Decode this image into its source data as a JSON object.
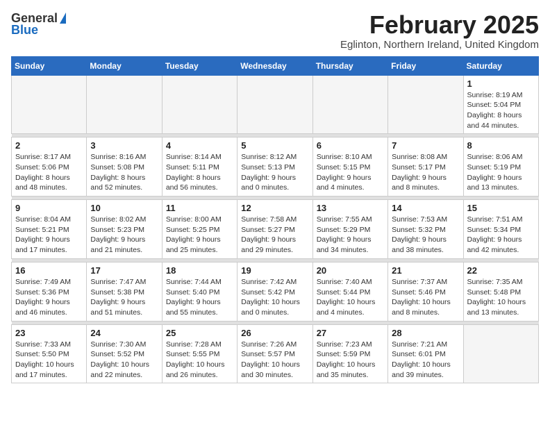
{
  "header": {
    "logo_general": "General",
    "logo_blue": "Blue",
    "title": "February 2025",
    "location": "Eglinton, Northern Ireland, United Kingdom"
  },
  "weekdays": [
    "Sunday",
    "Monday",
    "Tuesday",
    "Wednesday",
    "Thursday",
    "Friday",
    "Saturday"
  ],
  "weeks": [
    [
      {
        "day": "",
        "info": ""
      },
      {
        "day": "",
        "info": ""
      },
      {
        "day": "",
        "info": ""
      },
      {
        "day": "",
        "info": ""
      },
      {
        "day": "",
        "info": ""
      },
      {
        "day": "",
        "info": ""
      },
      {
        "day": "1",
        "info": "Sunrise: 8:19 AM\nSunset: 5:04 PM\nDaylight: 8 hours and 44 minutes."
      }
    ],
    [
      {
        "day": "2",
        "info": "Sunrise: 8:17 AM\nSunset: 5:06 PM\nDaylight: 8 hours and 48 minutes."
      },
      {
        "day": "3",
        "info": "Sunrise: 8:16 AM\nSunset: 5:08 PM\nDaylight: 8 hours and 52 minutes."
      },
      {
        "day": "4",
        "info": "Sunrise: 8:14 AM\nSunset: 5:11 PM\nDaylight: 8 hours and 56 minutes."
      },
      {
        "day": "5",
        "info": "Sunrise: 8:12 AM\nSunset: 5:13 PM\nDaylight: 9 hours and 0 minutes."
      },
      {
        "day": "6",
        "info": "Sunrise: 8:10 AM\nSunset: 5:15 PM\nDaylight: 9 hours and 4 minutes."
      },
      {
        "day": "7",
        "info": "Sunrise: 8:08 AM\nSunset: 5:17 PM\nDaylight: 9 hours and 8 minutes."
      },
      {
        "day": "8",
        "info": "Sunrise: 8:06 AM\nSunset: 5:19 PM\nDaylight: 9 hours and 13 minutes."
      }
    ],
    [
      {
        "day": "9",
        "info": "Sunrise: 8:04 AM\nSunset: 5:21 PM\nDaylight: 9 hours and 17 minutes."
      },
      {
        "day": "10",
        "info": "Sunrise: 8:02 AM\nSunset: 5:23 PM\nDaylight: 9 hours and 21 minutes."
      },
      {
        "day": "11",
        "info": "Sunrise: 8:00 AM\nSunset: 5:25 PM\nDaylight: 9 hours and 25 minutes."
      },
      {
        "day": "12",
        "info": "Sunrise: 7:58 AM\nSunset: 5:27 PM\nDaylight: 9 hours and 29 minutes."
      },
      {
        "day": "13",
        "info": "Sunrise: 7:55 AM\nSunset: 5:29 PM\nDaylight: 9 hours and 34 minutes."
      },
      {
        "day": "14",
        "info": "Sunrise: 7:53 AM\nSunset: 5:32 PM\nDaylight: 9 hours and 38 minutes."
      },
      {
        "day": "15",
        "info": "Sunrise: 7:51 AM\nSunset: 5:34 PM\nDaylight: 9 hours and 42 minutes."
      }
    ],
    [
      {
        "day": "16",
        "info": "Sunrise: 7:49 AM\nSunset: 5:36 PM\nDaylight: 9 hours and 46 minutes."
      },
      {
        "day": "17",
        "info": "Sunrise: 7:47 AM\nSunset: 5:38 PM\nDaylight: 9 hours and 51 minutes."
      },
      {
        "day": "18",
        "info": "Sunrise: 7:44 AM\nSunset: 5:40 PM\nDaylight: 9 hours and 55 minutes."
      },
      {
        "day": "19",
        "info": "Sunrise: 7:42 AM\nSunset: 5:42 PM\nDaylight: 10 hours and 0 minutes."
      },
      {
        "day": "20",
        "info": "Sunrise: 7:40 AM\nSunset: 5:44 PM\nDaylight: 10 hours and 4 minutes."
      },
      {
        "day": "21",
        "info": "Sunrise: 7:37 AM\nSunset: 5:46 PM\nDaylight: 10 hours and 8 minutes."
      },
      {
        "day": "22",
        "info": "Sunrise: 7:35 AM\nSunset: 5:48 PM\nDaylight: 10 hours and 13 minutes."
      }
    ],
    [
      {
        "day": "23",
        "info": "Sunrise: 7:33 AM\nSunset: 5:50 PM\nDaylight: 10 hours and 17 minutes."
      },
      {
        "day": "24",
        "info": "Sunrise: 7:30 AM\nSunset: 5:52 PM\nDaylight: 10 hours and 22 minutes."
      },
      {
        "day": "25",
        "info": "Sunrise: 7:28 AM\nSunset: 5:55 PM\nDaylight: 10 hours and 26 minutes."
      },
      {
        "day": "26",
        "info": "Sunrise: 7:26 AM\nSunset: 5:57 PM\nDaylight: 10 hours and 30 minutes."
      },
      {
        "day": "27",
        "info": "Sunrise: 7:23 AM\nSunset: 5:59 PM\nDaylight: 10 hours and 35 minutes."
      },
      {
        "day": "28",
        "info": "Sunrise: 7:21 AM\nSunset: 6:01 PM\nDaylight: 10 hours and 39 minutes."
      },
      {
        "day": "",
        "info": ""
      }
    ]
  ]
}
